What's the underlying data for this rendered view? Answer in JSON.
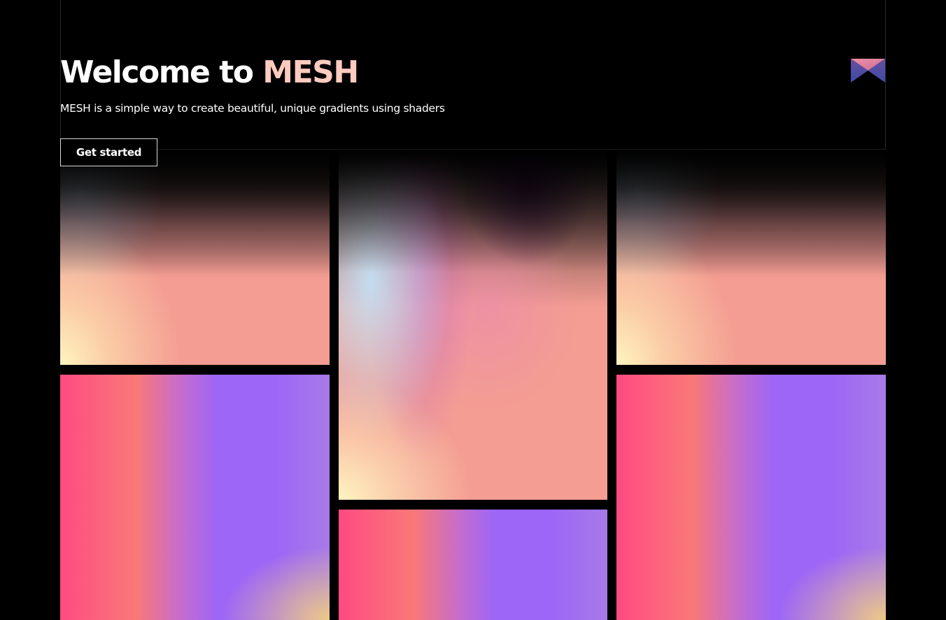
{
  "hero": {
    "title_prefix": "Welcome to",
    "brand": "MESH",
    "subtitle": "MESH is a simple way to create beautiful, unique gradients using shaders",
    "cta_label": "Get started"
  },
  "logo": {
    "icon": "mesh-logo-icon",
    "colors": [
      "#e8889a",
      "#4a3c8c",
      "#3b4aa8"
    ]
  },
  "gallery": {
    "tiles": [
      {
        "name": "gradient-tile-warm-1",
        "style": "warm"
      },
      {
        "name": "gradient-tile-warm-tall",
        "style": "warm-tall"
      },
      {
        "name": "gradient-tile-warm-2",
        "style": "warm"
      },
      {
        "name": "gradient-tile-cool-1",
        "style": "cool"
      },
      {
        "name": "gradient-tile-cool-short",
        "style": "cool-short"
      },
      {
        "name": "gradient-tile-cool-2",
        "style": "cool"
      }
    ]
  },
  "colors": {
    "background": "#000000",
    "text": "#ffffff",
    "brand_accent": "#ffcbbf",
    "warm_peach": "#f49d92",
    "cool_violet": "#9d66f6",
    "hot_pink": "#ff4a82"
  }
}
